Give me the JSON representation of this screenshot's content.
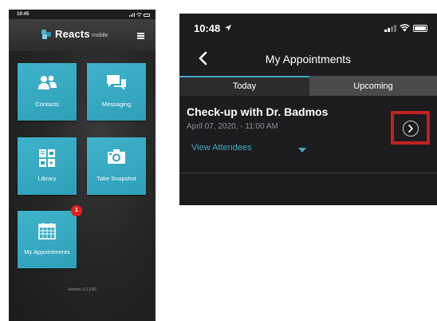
{
  "left_phone": {
    "status_time": "10:45",
    "brand": "Reacts",
    "brand_sub": "mobile",
    "tiles": [
      {
        "label": "Contacts",
        "icon": "contacts-icon"
      },
      {
        "label": "Messaging",
        "icon": "messaging-icon"
      },
      {
        "label": "Library",
        "icon": "library-icon"
      },
      {
        "label": "Take Snapshot",
        "icon": "camera-icon"
      },
      {
        "label": "My Appointments",
        "icon": "calendar-icon",
        "badge": "1"
      }
    ],
    "version": "Version 3.3.3.62"
  },
  "right_phone": {
    "status_time": "10:48",
    "title": "My Appointments",
    "tabs": [
      {
        "label": "Today",
        "active": true
      },
      {
        "label": "Upcoming",
        "active": false
      }
    ],
    "appointment": {
      "title": "Check-up with Dr. Badmos",
      "date": "April 07, 2020, - 11:00 AM",
      "attendees_label": "View Attendees"
    }
  },
  "colors": {
    "tile": "#3aaec6",
    "accent": "#42a7c5",
    "highlight": "#c0201d",
    "badge": "#e02020"
  }
}
